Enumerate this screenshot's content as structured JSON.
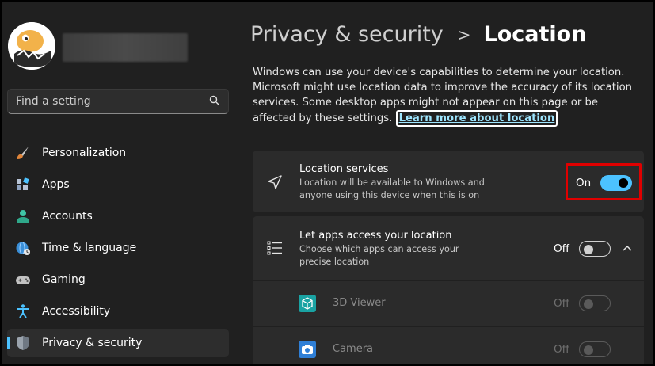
{
  "sidebar": {
    "search_placeholder": "Find a setting",
    "items": [
      {
        "label": "Personalization",
        "icon": "brush-icon"
      },
      {
        "label": "Apps",
        "icon": "apps-icon"
      },
      {
        "label": "Accounts",
        "icon": "person-icon"
      },
      {
        "label": "Time & language",
        "icon": "globe-clock-icon"
      },
      {
        "label": "Gaming",
        "icon": "gamepad-icon"
      },
      {
        "label": "Accessibility",
        "icon": "accessibility-icon"
      },
      {
        "label": "Privacy & security",
        "icon": "shield-icon",
        "active": true
      }
    ]
  },
  "header": {
    "parent": "Privacy & security",
    "separator": ">",
    "current": "Location"
  },
  "description": {
    "text": "Windows can use your device's capabilities to determine your location. Microsoft might use location data to improve the accuracy of its location services. Some desktop apps might not appear on this page or be affected by these settings.",
    "link": "Learn more about location"
  },
  "location_services": {
    "title": "Location services",
    "subtitle": "Location will be available to Windows and anyone using this device when this is on",
    "state_label": "On",
    "on": true
  },
  "app_access": {
    "title": "Let apps access your location",
    "subtitle": "Choose which apps can access your precise location",
    "state_label": "Off",
    "on": false
  },
  "apps": [
    {
      "name": "3D Viewer",
      "state_label": "Off",
      "icon": "cube-icon"
    },
    {
      "name": "Camera",
      "state_label": "Off",
      "icon": "camera-icon"
    }
  ],
  "colors": {
    "accent": "#4cc2ff",
    "highlight": "#e00000",
    "background": "#202020",
    "card": "#2b2b2b"
  }
}
